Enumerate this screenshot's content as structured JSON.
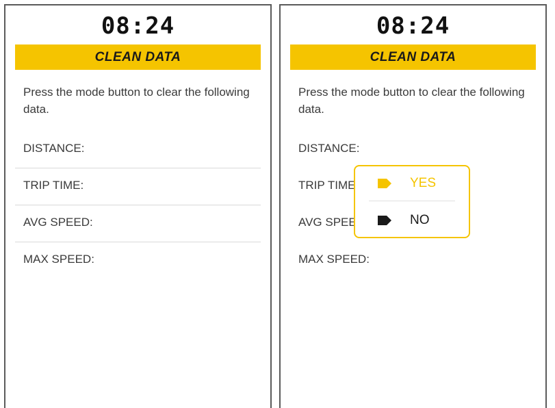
{
  "colors": {
    "accent": "#f5c400",
    "text": "#3a3a3a",
    "divider": "#d9d9d9"
  },
  "screens": [
    {
      "clock": "08:24",
      "title": "CLEAN DATA",
      "instructions": "Press the mode button to clear the following data.",
      "rows": [
        "DISTANCE:",
        "TRIP TIME:",
        "AVG SPEED:",
        "MAX SPEED:"
      ]
    },
    {
      "clock": "08:24",
      "title": "CLEAN DATA",
      "instructions": "Press the mode button to clear the following data.",
      "rows": [
        "DISTANCE:",
        "TRIP TIME:",
        "AVG SPEED:",
        "MAX SPEED:"
      ],
      "popup": {
        "options": [
          {
            "label": "YES",
            "icon": "tag-icon",
            "selected": true
          },
          {
            "label": "NO",
            "icon": "tag-icon",
            "selected": false
          }
        ]
      }
    }
  ]
}
